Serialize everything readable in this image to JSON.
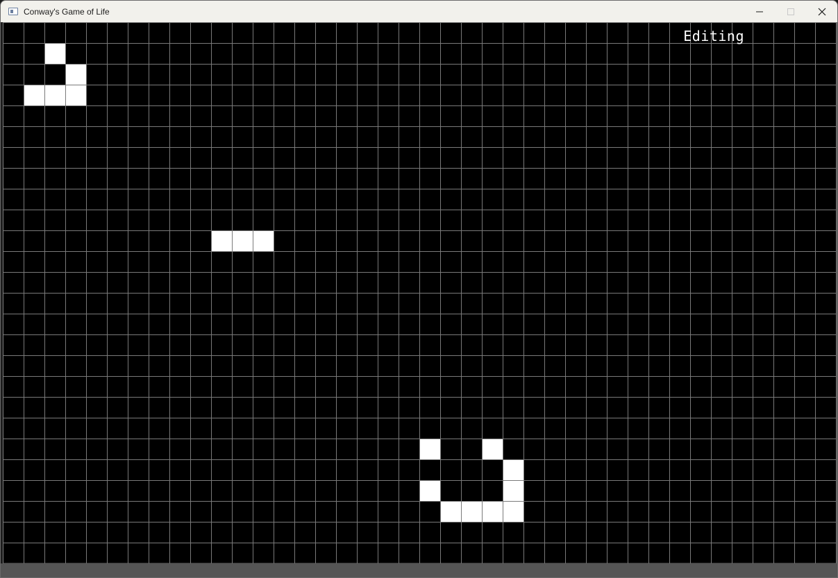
{
  "window": {
    "title": "Conway's Game of Life",
    "icons": {
      "app": "app-window-icon",
      "minimize": "minimize-icon",
      "maximize": "maximize-icon",
      "close": "close-icon"
    }
  },
  "status": {
    "mode": "Editing"
  },
  "grid": {
    "columns": 40,
    "rows": 26,
    "line_color": "#7a7a7a",
    "live_cell_color": "#ffffff",
    "background_color": "#000000",
    "live_cells": [
      {
        "col": 2,
        "row": 1
      },
      {
        "col": 3,
        "row": 2
      },
      {
        "col": 1,
        "row": 3
      },
      {
        "col": 2,
        "row": 3
      },
      {
        "col": 3,
        "row": 3
      },
      {
        "col": 10,
        "row": 10
      },
      {
        "col": 11,
        "row": 10
      },
      {
        "col": 12,
        "row": 10
      },
      {
        "col": 20,
        "row": 20
      },
      {
        "col": 23,
        "row": 20
      },
      {
        "col": 24,
        "row": 21
      },
      {
        "col": 20,
        "row": 22
      },
      {
        "col": 24,
        "row": 22
      },
      {
        "col": 21,
        "row": 23
      },
      {
        "col": 22,
        "row": 23
      },
      {
        "col": 23,
        "row": 23
      },
      {
        "col": 24,
        "row": 23
      }
    ]
  }
}
